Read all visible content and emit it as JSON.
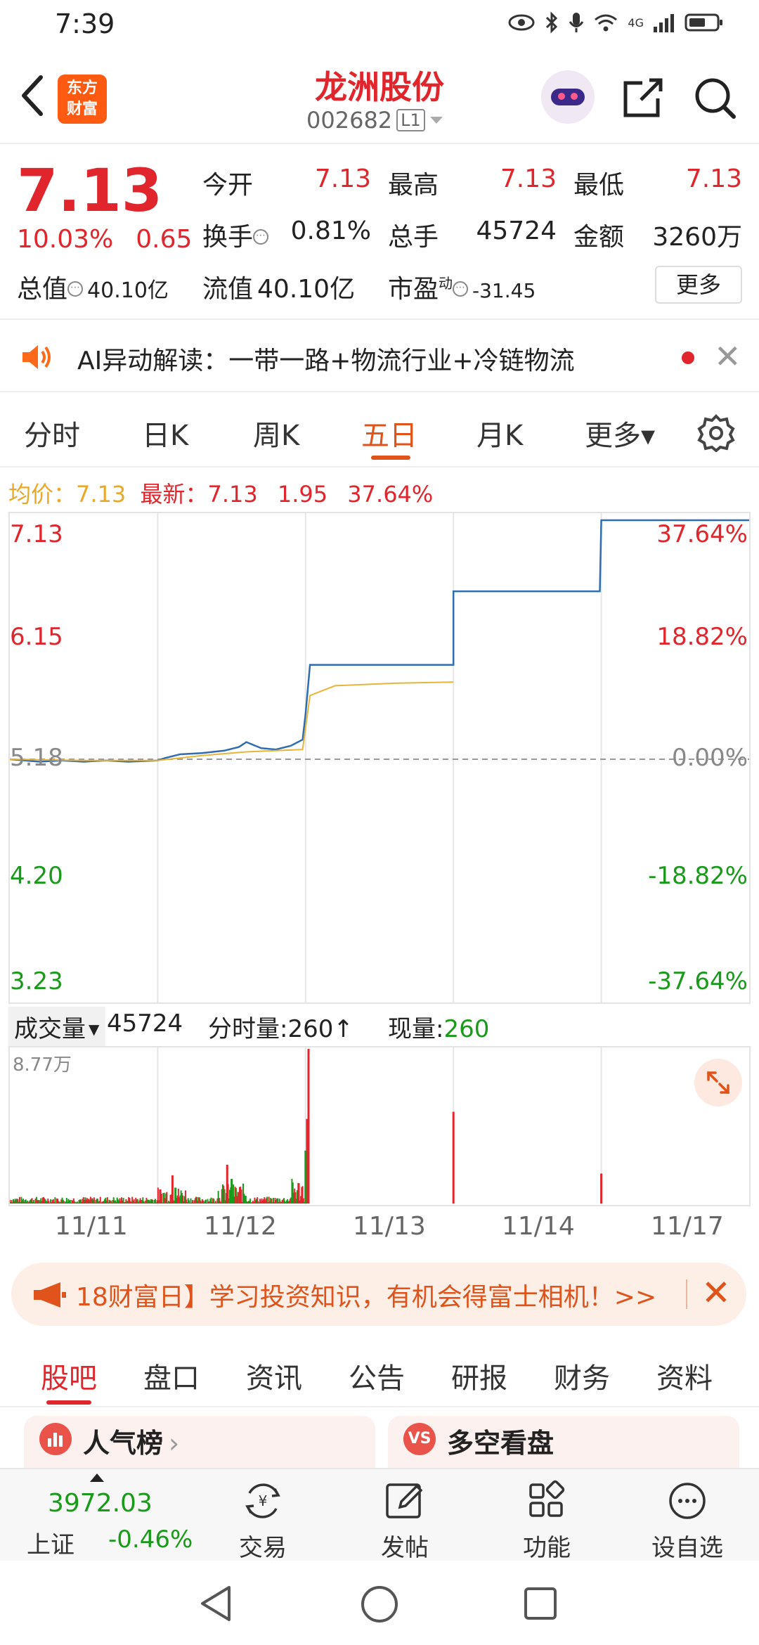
{
  "status": {
    "time": "7:39",
    "network": "4G"
  },
  "header": {
    "stock_name": "龙洲股份",
    "stock_code": "002682",
    "level_badge": "L1",
    "logo_line1": "东方",
    "logo_line2": "财富"
  },
  "quote": {
    "price": "7.13",
    "pct_change": "10.03%",
    "abs_change": "0.65",
    "open_label": "今开",
    "open": "7.13",
    "high_label": "最高",
    "high": "7.13",
    "low_label": "最低",
    "low": "7.13",
    "turnover_label": "换手",
    "turnover": "0.81%",
    "volume_label": "总手",
    "volume": "45724",
    "amount_label": "金额",
    "amount": "3260万",
    "mktcap_label": "总值",
    "mktcap": "40.10亿",
    "float_label": "流值",
    "float": "40.10亿",
    "pe_label": "市盈",
    "pe_sup": "动",
    "pe": "-31.45",
    "more_button": "更多"
  },
  "ai_banner": {
    "text": "AI异动解读：一带一路+物流行业+冷链物流"
  },
  "period_tabs": {
    "items": [
      "分时",
      "日K",
      "周K",
      "五日",
      "月K",
      "更多▾"
    ],
    "active": "五日"
  },
  "avg_row": {
    "avg_label": "均价：",
    "avg_value": "7.13",
    "latest_label": "最新：",
    "latest_value": "7.13",
    "change_value": "1.95",
    "change_pct": "37.64%"
  },
  "chart_data": [
    {
      "type": "line",
      "title": "",
      "x_days": [
        "11/11",
        "11/12",
        "11/13",
        "11/14",
        "11/17"
      ],
      "y_ticks_left": [
        "7.13",
        "6.15",
        "5.18",
        "4.20",
        "3.23"
      ],
      "y_ticks_right": [
        "37.64%",
        "18.82%",
        "0.00%",
        "-18.82%",
        "-37.64%"
      ],
      "ylim": [
        3.23,
        7.13
      ],
      "prev_close": 5.18,
      "series": [
        {
          "name": "最新",
          "color": "#2f6db0",
          "points": [
            [
              0.0,
              5.18
            ],
            [
              0.1,
              5.17
            ],
            [
              0.2,
              5.16
            ],
            [
              0.35,
              5.17
            ],
            [
              0.5,
              5.16
            ],
            [
              0.65,
              5.17
            ],
            [
              0.8,
              5.16
            ],
            [
              1.0,
              5.17
            ],
            [
              1.05,
              5.19
            ],
            [
              1.15,
              5.22
            ],
            [
              1.3,
              5.23
            ],
            [
              1.45,
              5.25
            ],
            [
              1.55,
              5.28
            ],
            [
              1.6,
              5.32
            ],
            [
              1.7,
              5.27
            ],
            [
              1.8,
              5.26
            ],
            [
              1.9,
              5.29
            ],
            [
              1.98,
              5.34
            ],
            [
              2.0,
              5.55
            ],
            [
              2.03,
              5.95
            ],
            [
              2.5,
              5.95
            ],
            [
              3.0,
              5.95
            ],
            [
              3.0,
              6.55
            ],
            [
              3.5,
              6.55
            ],
            [
              3.99,
              6.55
            ],
            [
              4.0,
              7.13
            ],
            [
              5.0,
              7.13
            ]
          ]
        },
        {
          "name": "均价",
          "color": "#e8b43a",
          "points": [
            [
              0.0,
              5.18
            ],
            [
              0.5,
              5.17
            ],
            [
              1.0,
              5.17
            ],
            [
              1.3,
              5.21
            ],
            [
              1.6,
              5.24
            ],
            [
              1.98,
              5.26
            ],
            [
              2.03,
              5.7
            ],
            [
              2.2,
              5.78
            ],
            [
              2.6,
              5.8
            ],
            [
              3.0,
              5.81
            ]
          ]
        }
      ]
    },
    {
      "type": "bar",
      "title": "成交量",
      "ymax_label": "8.77万",
      "ymax": 87700,
      "x_days": [
        "11/11",
        "11/12",
        "11/13",
        "11/14",
        "11/17"
      ],
      "spikes": [
        {
          "x": 2.02,
          "value": 87700,
          "color": "#e0262c"
        },
        {
          "x": 2.01,
          "value": 48000,
          "color": "#e0262c"
        },
        {
          "x": 2.0,
          "value": 30000,
          "color": "#1a9a1a"
        },
        {
          "x": 1.47,
          "value": 22000,
          "color": "#e0262c"
        },
        {
          "x": 1.5,
          "value": 14000,
          "color": "#1a9a1a"
        },
        {
          "x": 1.1,
          "value": 16000,
          "color": "#e0262c"
        },
        {
          "x": 1.12,
          "value": 9000,
          "color": "#1a9a1a"
        },
        {
          "x": 3.0,
          "value": 52000,
          "color": "#e0262c"
        },
        {
          "x": 4.0,
          "value": 17000,
          "color": "#e0262c"
        }
      ]
    }
  ],
  "volume_head": {
    "selector": "成交量",
    "total": "45724",
    "tick_label": "分时量:",
    "tick_value": "260",
    "tick_arrow": "↑",
    "now_label": "现量:",
    "now_value": "260"
  },
  "promo": {
    "text": "18财富日】学习投资知识，有机会得富士相机！>>"
  },
  "content_tabs": {
    "items": [
      "股吧",
      "盘口",
      "资讯",
      "公告",
      "研报",
      "财务",
      "资料"
    ],
    "active": "股吧"
  },
  "cards": [
    {
      "title": "人气榜",
      "arrow": "›"
    },
    {
      "title": "多空看盘",
      "icon": "VS"
    }
  ],
  "bottom_bar": {
    "index_value": "3972.03",
    "index_name": "上证",
    "index_change": "-0.46%",
    "items": [
      "交易",
      "发帖",
      "功能",
      "设自选"
    ]
  }
}
